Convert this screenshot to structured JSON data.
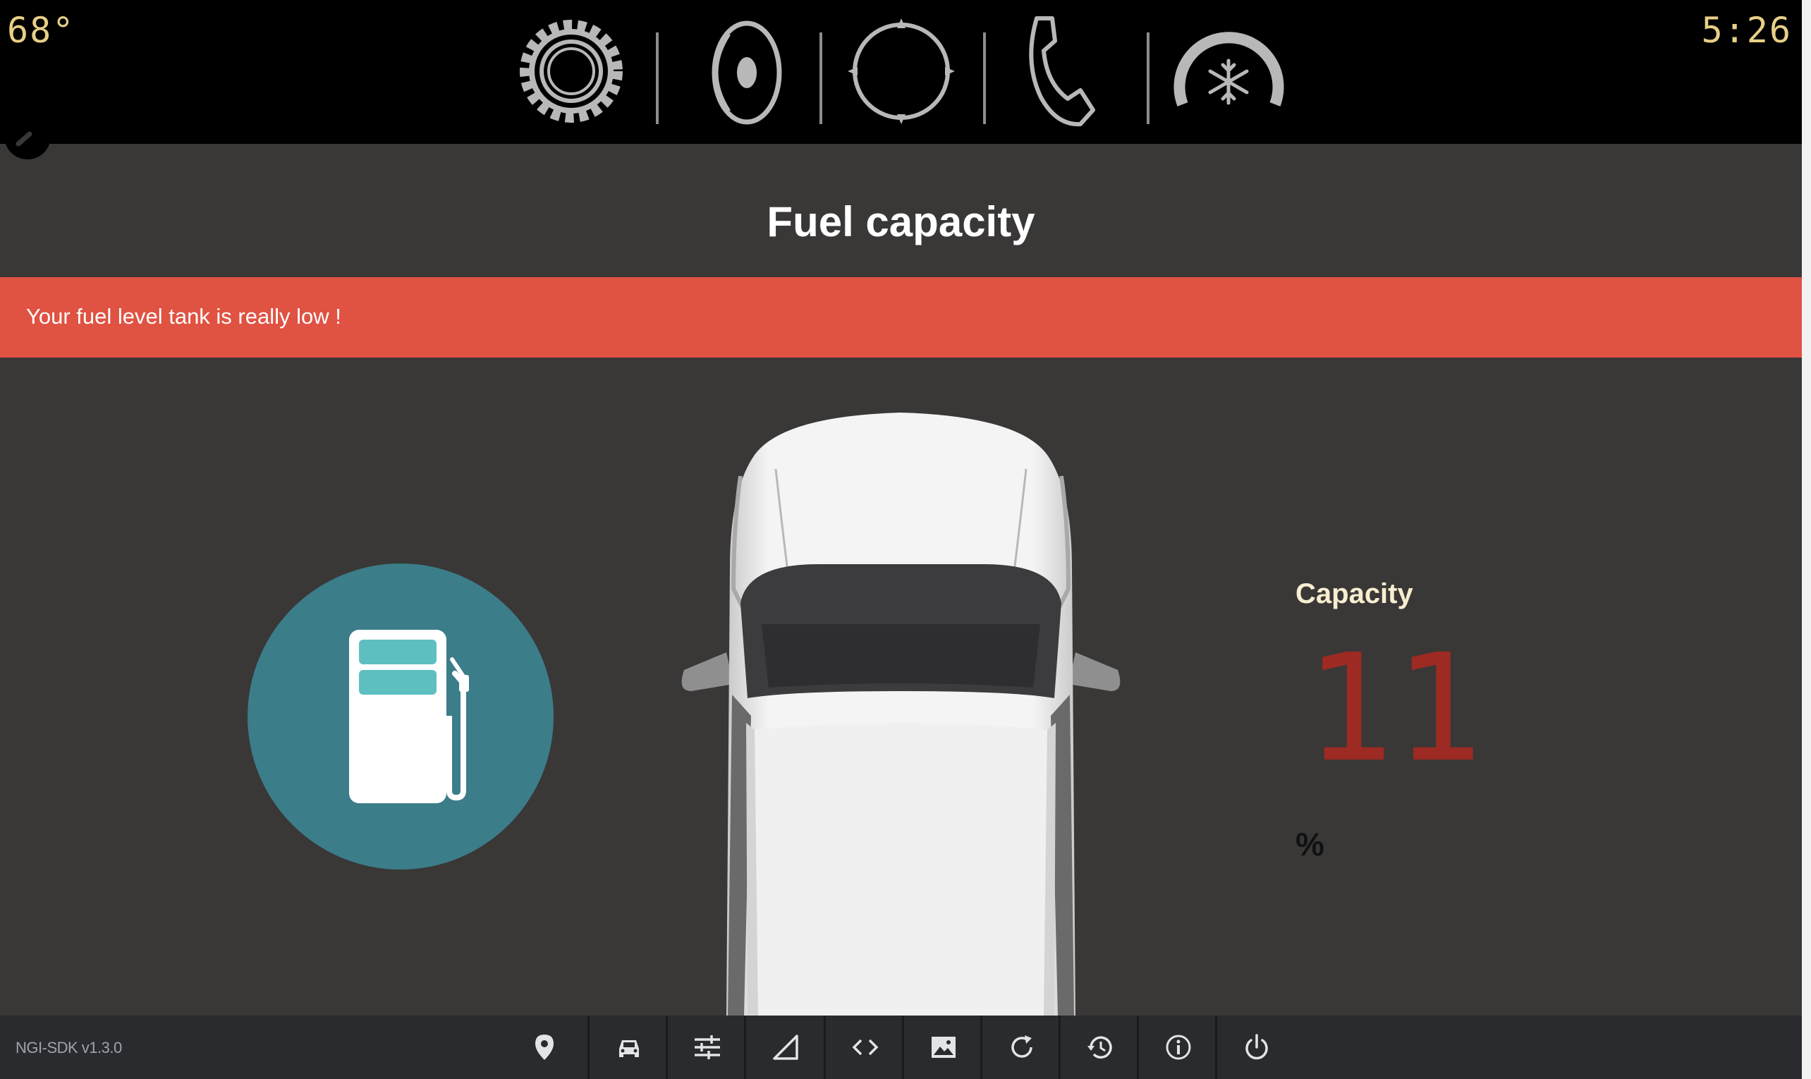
{
  "status_bar": {
    "temperature": "68°",
    "time": "5:26",
    "icons": [
      "settings-gear-icon",
      "audio-speaker-icon",
      "navigation-compass-icon",
      "phone-icon",
      "climate-fan-icon"
    ]
  },
  "page": {
    "title": "Fuel capacity",
    "alert": "Your fuel level tank is really low !"
  },
  "fuel": {
    "label": "Capacity",
    "value": "11",
    "unit": "%"
  },
  "colors": {
    "background": "#3a3737",
    "top_bar": "#000000",
    "alert": "#e05242",
    "fuel_circle": "#3b7d89",
    "pump_window": "#5ebfc0",
    "capacity_value": "#9d2a23",
    "status_text": "#e7cf86",
    "bottom_bar": "#2a2b2e"
  },
  "bottom_bar": {
    "version": "NGI-SDK v1.3.0",
    "icons": [
      "location-pin-icon",
      "car-icon",
      "sliders-icon",
      "signal-icon",
      "code-icon",
      "image-icon",
      "refresh-icon",
      "history-icon",
      "info-icon",
      "power-icon"
    ]
  }
}
